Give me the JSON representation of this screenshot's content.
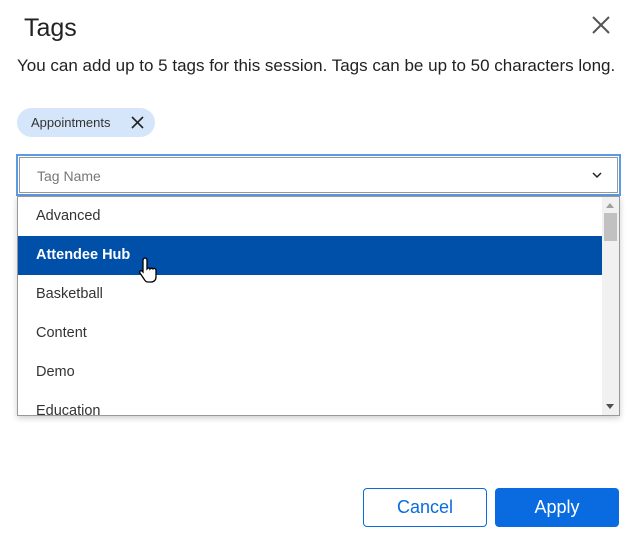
{
  "dialog": {
    "title": "Tags",
    "description": "You can add up to 5 tags for this session. Tags can be up to 50 characters long.",
    "chips": [
      {
        "label": "Appointments"
      }
    ],
    "select": {
      "placeholder": "Tag Name",
      "highlighted": "Attendee Hub",
      "options": [
        "Advanced",
        "Attendee Hub",
        "Basketball",
        "Content",
        "Demo",
        "Education"
      ]
    },
    "buttons": {
      "cancel": "Cancel",
      "apply": "Apply"
    }
  },
  "colors": {
    "accent": "#0a6be0",
    "highlight": "#0050aa",
    "chip": "#d6e6fa"
  }
}
